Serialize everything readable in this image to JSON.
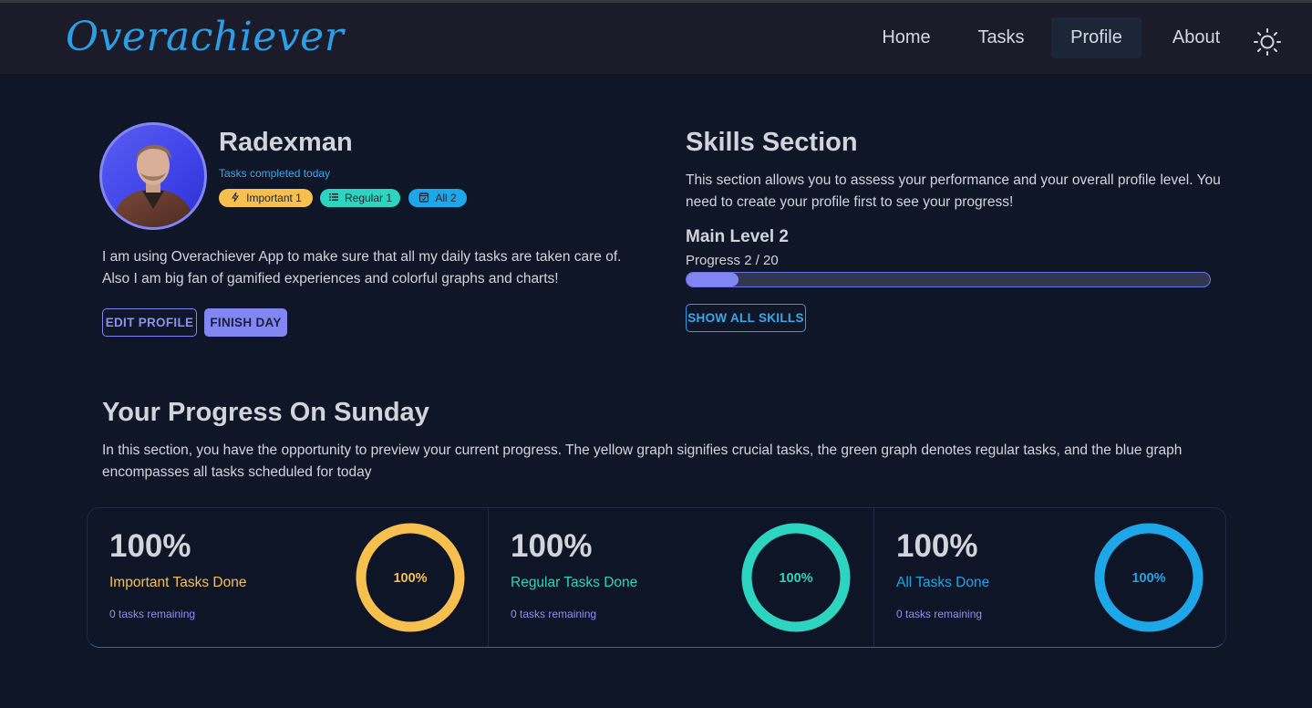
{
  "app": {
    "logo": "Overachiever"
  },
  "nav": {
    "items": [
      {
        "label": "Home"
      },
      {
        "label": "Tasks"
      },
      {
        "label": "Profile"
      },
      {
        "label": "About"
      }
    ],
    "active": "Profile",
    "theme_icon": "sun-icon"
  },
  "profile": {
    "name": "Radexman",
    "subtitle": "Tasks completed today",
    "badges": [
      {
        "icon": "bolt-icon",
        "label": "Important 1",
        "color": "#f7c04e"
      },
      {
        "icon": "list-icon",
        "label": "Regular 1",
        "color": "#2dd4bf"
      },
      {
        "icon": "calendar-check-icon",
        "label": "All 2",
        "color": "#1ea7e8"
      }
    ],
    "bio": "I am using Overachiever App to make sure that all my daily tasks are taken care of. Also I am big fan of gamified experiences and colorful graphs and charts!",
    "edit_label": "EDIT PROFILE",
    "finish_label": "FINISH DAY"
  },
  "skills": {
    "title": "Skills Section",
    "description": "This section allows you to assess your performance and your overall profile level. You need to create your profile first to see your progress!",
    "level_title": "Main Level 2",
    "progress_label": "Progress 2 / 20",
    "progress_current": 2,
    "progress_total": 20,
    "show_all_label": "SHOW ALL SKILLS"
  },
  "progress": {
    "title": "Your Progress On Sunday",
    "description": "In this section, you have the opportunity to preview your current progress. The yellow graph signifies crucial tasks, the green graph denotes regular tasks, and the blue graph encompasses all tasks scheduled for today",
    "stats": [
      {
        "value": "100%",
        "label": "Important Tasks Done",
        "remaining": "0 tasks remaining",
        "ring_text": "100%",
        "percent": 100,
        "color": "#f7c04e"
      },
      {
        "value": "100%",
        "label": "Regular Tasks Done",
        "remaining": "0 tasks remaining",
        "ring_text": "100%",
        "percent": 100,
        "color": "#2dd4bf"
      },
      {
        "value": "100%",
        "label": "All Tasks Done",
        "remaining": "0 tasks remaining",
        "ring_text": "100%",
        "percent": 100,
        "color": "#1ea7e8"
      }
    ]
  },
  "colors": {
    "accent": "#8186f2",
    "brand": "#2a9fe6",
    "background": "#0f1628",
    "navbar": "#1c1b29"
  }
}
